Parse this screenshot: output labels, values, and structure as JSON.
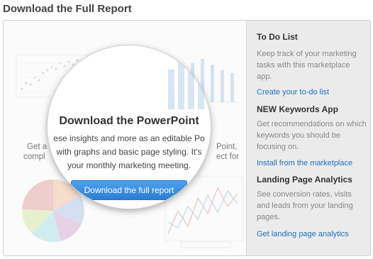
{
  "page": {
    "heading": "Download the Full Report"
  },
  "preview": {
    "lens_title": "Download the PowerPoint",
    "lens_line1": "ese insights and more as an editable Po",
    "lens_line2": "with graphs and basic page styling. It's",
    "lens_line3": "your monthly marketing meeting.",
    "download_button": "Download the full report",
    "bg_left1": "Get a",
    "bg_left2": "compl",
    "bg_right1": "Point,",
    "bg_right2": "ect for"
  },
  "sidebar": {
    "sections": [
      {
        "title": "To Do List",
        "desc": "Keep track of your marketing tasks with this marketplace app.",
        "link": "Create your to-do list"
      },
      {
        "title": "NEW Keywords App",
        "desc": "Get recommendations on which keywords you should be focusing on.",
        "link": "Install from the marketplace"
      },
      {
        "title": "Landing Page Analytics",
        "desc": "See conversion rates, visits and leads from your landing pages.",
        "link": "Get landing page analytics"
      }
    ]
  },
  "colors": {
    "link": "#1d6fbf",
    "button": "#2b7ed6",
    "sidebar_bg": "#ebebeb"
  }
}
